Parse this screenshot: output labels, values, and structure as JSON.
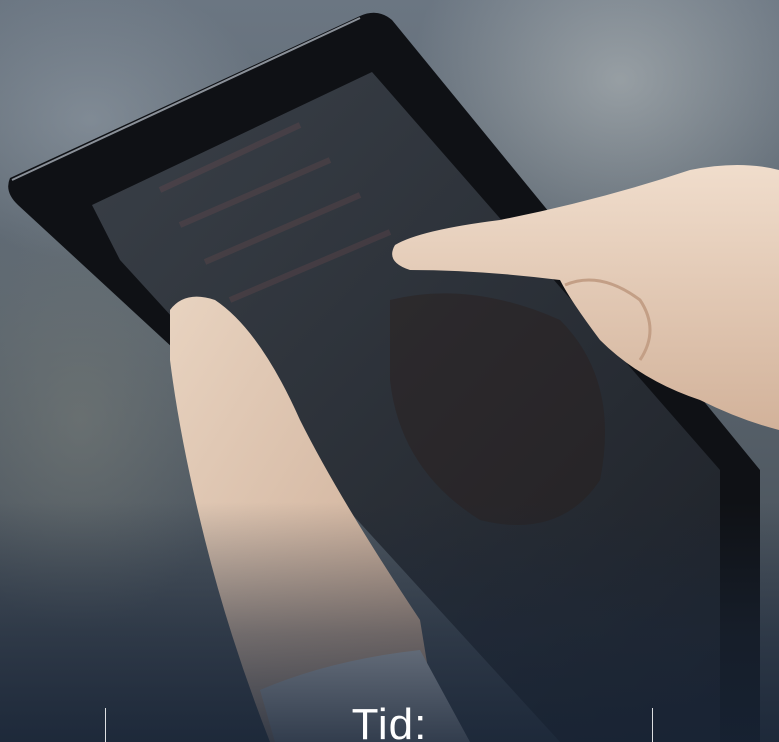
{
  "caption": {
    "text": "Tid:"
  },
  "colors": {
    "caption_text": "#ffffff",
    "overlay": "#1c2a3a"
  },
  "icons": [
    "tablet-illustration"
  ]
}
